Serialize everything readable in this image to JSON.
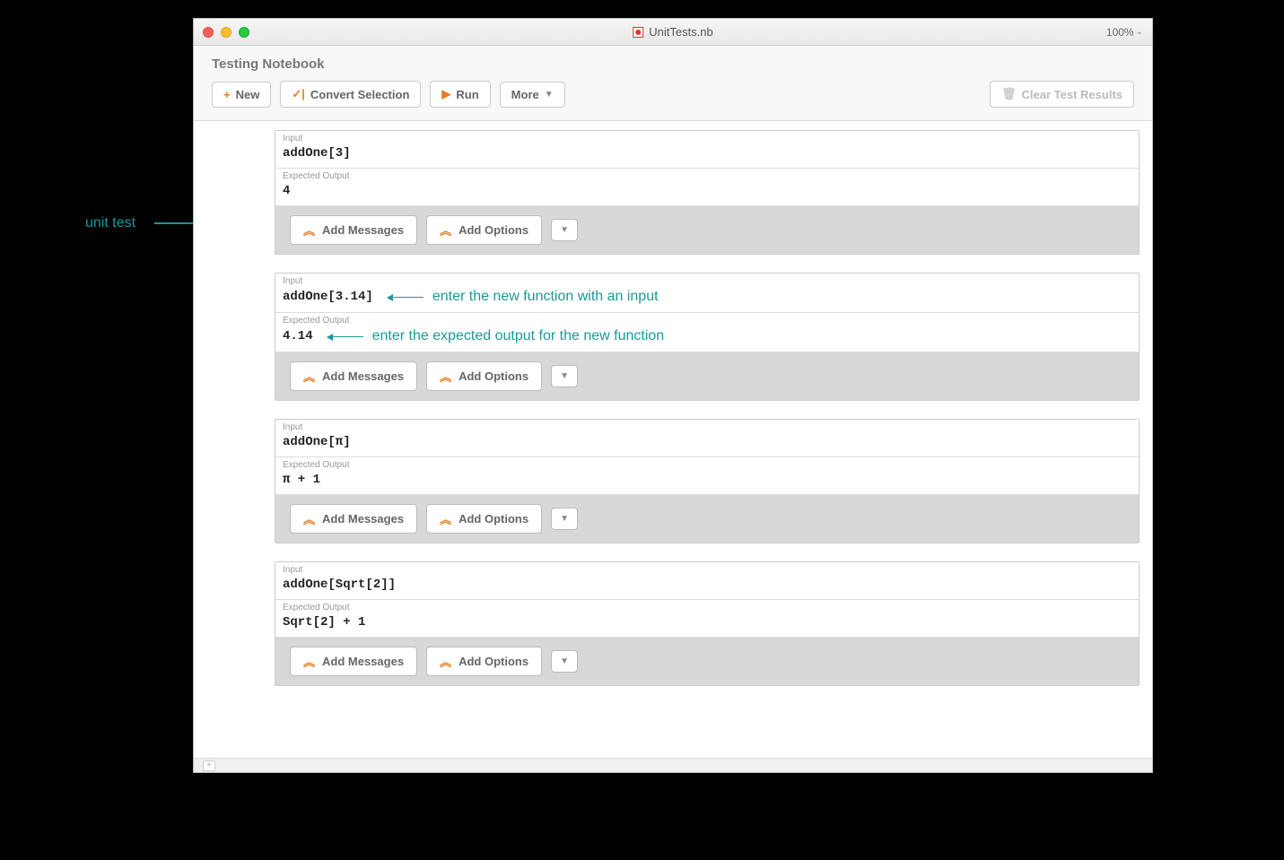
{
  "titlebar": {
    "title": "UnitTests.nb",
    "zoom": "100%"
  },
  "header": {
    "title": "Testing Notebook"
  },
  "toolbar": {
    "new": "New",
    "convert": "Convert Selection",
    "run": "Run",
    "more": "More",
    "clear": "Clear Test Results"
  },
  "labels": {
    "input": "Input",
    "expected": "Expected Output",
    "addMessages": "Add Messages",
    "addOptions": "Add Options"
  },
  "tests": [
    {
      "input": "addOne[3]",
      "expected": "4"
    },
    {
      "input": "addOne[3.14]",
      "expected": "4.14"
    },
    {
      "input": "addOne[π]",
      "expected": "π + 1"
    },
    {
      "input": "addOne[Sqrt[2]]",
      "expected": "Sqrt[2] + 1"
    }
  ],
  "annotations": {
    "unitTest": "unit test",
    "inputAnno": "enter the new function with an input",
    "outputAnno": "enter the expected output for the new function"
  }
}
